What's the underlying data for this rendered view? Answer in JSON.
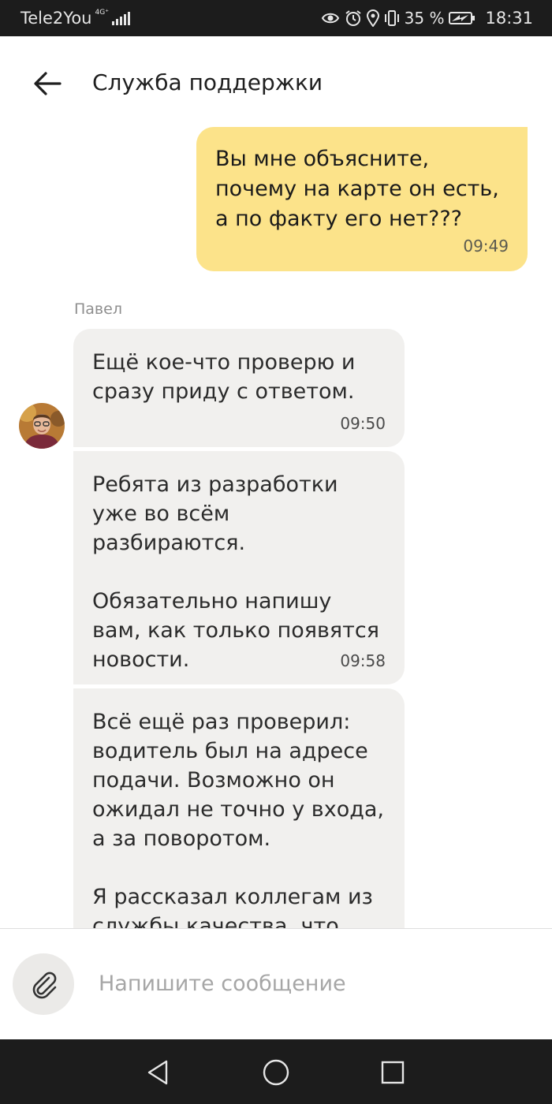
{
  "status_bar": {
    "carrier": "Tele2You",
    "network_type": "4G⁺",
    "battery_percent": "35 %",
    "time": "18:31",
    "icons": [
      "eye-icon",
      "alarm-icon",
      "location-icon",
      "vibrate-icon",
      "battery-icon"
    ]
  },
  "header": {
    "title": "Служба поддержки",
    "back_icon": "arrow-left-icon"
  },
  "messages": [
    {
      "direction": "outgoing",
      "text": "Вы мне объясните, почему на карте он есть, а по факту его нет???",
      "time": "09:49"
    },
    {
      "direction": "incoming",
      "sender": "Павел",
      "text": "Ещё кое-что проверю и сразу приду с ответом.",
      "time": "09:50"
    },
    {
      "direction": "incoming",
      "text": "Ребята из разработки уже во всём разбираются.\n\nОбязательно напишу вам, как только появятся новости.",
      "time": "09:58"
    },
    {
      "direction": "incoming",
      "text": "Всё ещё раз проверил: водитель был на адресе подачи. Возможно он ожидал не точно у входа, а за поворотом.\n\nЯ рассказал коллегам из службы качества, что"
    }
  ],
  "composer": {
    "placeholder": "Напишите сообщение",
    "attach_icon": "paperclip-icon"
  },
  "nav_bar": {
    "icons": [
      "back-triangle-icon",
      "home-circle-icon",
      "recents-square-icon"
    ]
  },
  "colors": {
    "outgoing_bubble": "#fce38a",
    "incoming_bubble": "#f1f0ee",
    "system_bars": "#1c1c1c"
  }
}
